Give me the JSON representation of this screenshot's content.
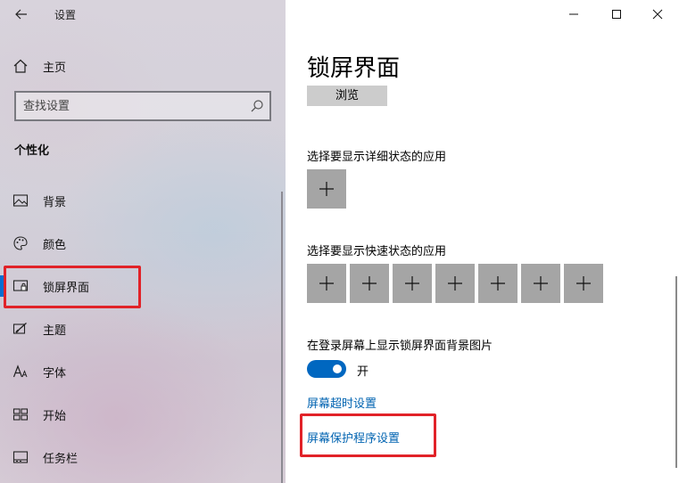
{
  "app_title": "设置",
  "home_label": "主页",
  "search": {
    "placeholder": "查找设置"
  },
  "section_title": "个性化",
  "nav_items": [
    {
      "label": "背景",
      "icon": "picture-icon"
    },
    {
      "label": "颜色",
      "icon": "palette-icon"
    },
    {
      "label": "锁屏界面",
      "icon": "lock-screen-icon",
      "selected": true
    },
    {
      "label": "主题",
      "icon": "theme-icon"
    },
    {
      "label": "字体",
      "icon": "font-icon"
    },
    {
      "label": "开始",
      "icon": "start-icon"
    },
    {
      "label": "任务栏",
      "icon": "taskbar-icon"
    }
  ],
  "page": {
    "title": "锁屏界面",
    "browse_label": "浏览",
    "detailed_status_label": "选择要显示详细状态的应用",
    "quick_status_label": "选择要显示快速状态的应用",
    "plus_glyph": "+",
    "show_bg_label": "在登录屏幕上显示锁屏界面背景图片",
    "toggle_state": "开",
    "toggle_on": true,
    "link_timeout": "屏幕超时设置",
    "link_screensaver": "屏幕保护程序设置"
  },
  "colors": {
    "accent": "#0067c0",
    "link": "#0063b1",
    "highlight_box": "#e12228",
    "tile": "#a5a5a5"
  }
}
